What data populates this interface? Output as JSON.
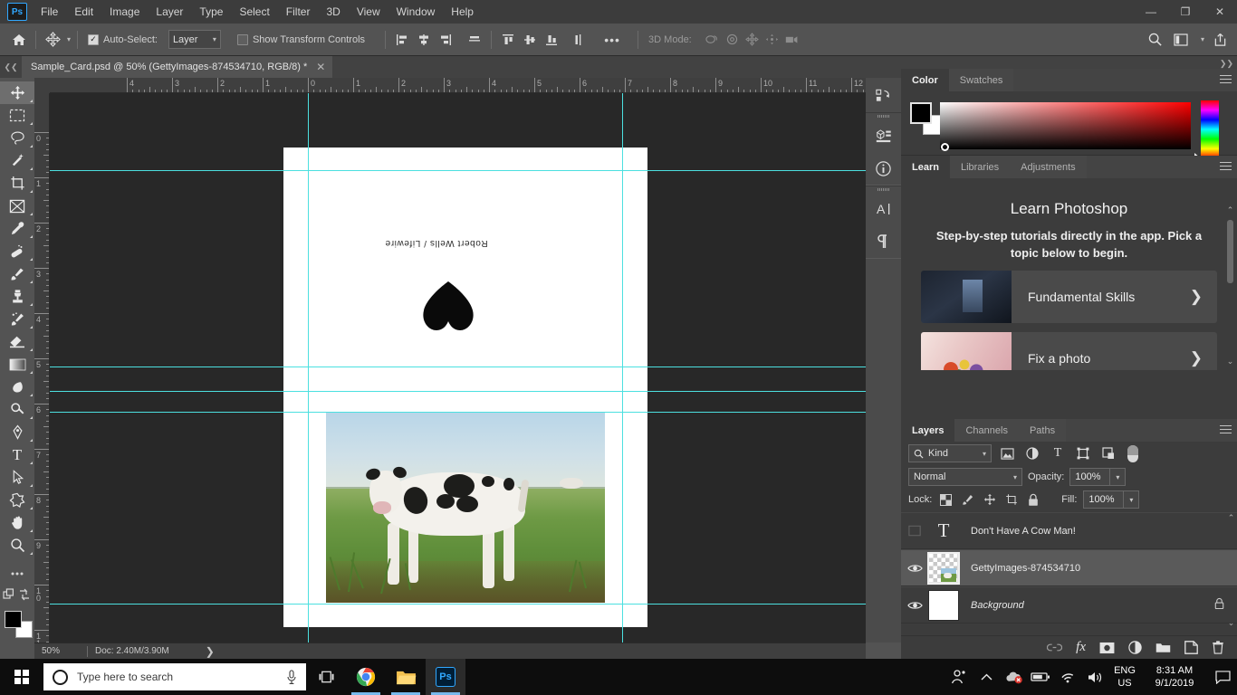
{
  "window": {
    "minimize": "—",
    "maximize": "❐",
    "close": "✕"
  },
  "menubar": {
    "logo": "Ps",
    "items": [
      "File",
      "Edit",
      "Image",
      "Layer",
      "Type",
      "Select",
      "Filter",
      "3D",
      "View",
      "Window",
      "Help"
    ]
  },
  "options_bar": {
    "home_icon": "home-icon",
    "tool_icon": "move-tool-icon",
    "auto_select_label": "Auto-Select:",
    "auto_select_checked": true,
    "layer_dropdown_value": "Layer",
    "show_transform_label": "Show Transform Controls",
    "show_transform_checked": false,
    "more_label": "•••",
    "three_d_label": "3D Mode:",
    "right_icons": [
      "search-icon",
      "workspace-icon",
      "chevron-down-icon",
      "share-icon"
    ]
  },
  "tabbar": {
    "document_title": "Sample_Card.psd @ 50% (GettyImages-874534710, RGB/8) *",
    "close_glyph": "✕",
    "collapse_glyph": "❮❮",
    "expand_glyph": "❯❯"
  },
  "toolbar": {
    "tools": [
      {
        "name": "move-tool",
        "active": true
      },
      {
        "name": "rectangular-marquee-tool",
        "active": false
      },
      {
        "name": "lasso-tool",
        "active": false
      },
      {
        "name": "magic-wand-tool",
        "active": false
      },
      {
        "name": "crop-tool",
        "active": false
      },
      {
        "name": "frame-tool",
        "active": false
      },
      {
        "name": "eyedropper-tool",
        "active": false
      },
      {
        "name": "spot-healing-brush-tool",
        "active": false
      },
      {
        "name": "brush-tool",
        "active": false
      },
      {
        "name": "clone-stamp-tool",
        "active": false
      },
      {
        "name": "history-brush-tool",
        "active": false
      },
      {
        "name": "eraser-tool",
        "active": false
      },
      {
        "name": "gradient-tool",
        "active": false
      },
      {
        "name": "blur-tool",
        "active": false
      },
      {
        "name": "dodge-tool",
        "active": false
      },
      {
        "name": "pen-tool",
        "active": false
      },
      {
        "name": "type-tool",
        "active": false
      },
      {
        "name": "path-selection-tool",
        "active": false
      },
      {
        "name": "custom-shape-tool",
        "active": false
      },
      {
        "name": "hand-tool",
        "active": false
      },
      {
        "name": "zoom-tool",
        "active": false
      },
      {
        "name": "edit-toolbar-more",
        "active": false
      }
    ],
    "foreground_color": "#000000",
    "background_color": "#ffffff"
  },
  "canvas": {
    "ruler_h_labels": [
      "4",
      "3",
      "2",
      "1",
      "0",
      "1",
      "2",
      "3",
      "4",
      "5",
      "6",
      "7",
      "8",
      "9",
      "10",
      "11",
      "12"
    ],
    "ruler_v_labels": [
      "0",
      "1",
      "2",
      "3",
      "4",
      "5",
      "6",
      "7",
      "8",
      "9",
      "10",
      "11"
    ],
    "credit_text": "Robert Wells / Lifewire",
    "guide_color": "#4ce0e0",
    "paper_color": "#ffffff"
  },
  "statusbar": {
    "zoom": "50%",
    "doc_info": "Doc: 2.40M/3.90M",
    "expand_glyph": "❯"
  },
  "icon_rail": {
    "items": [
      "history-icon",
      "3d-icon",
      "info-icon",
      "character-icon",
      "paragraph-icon"
    ]
  },
  "color_panel": {
    "tabs": [
      {
        "label": "Color",
        "active": true
      },
      {
        "label": "Swatches",
        "active": false
      }
    ],
    "foreground": "#000000",
    "background": "#ffffff"
  },
  "learn_panel": {
    "tabs": [
      {
        "label": "Learn",
        "active": true
      },
      {
        "label": "Libraries",
        "active": false
      },
      {
        "label": "Adjustments",
        "active": false
      }
    ],
    "title": "Learn Photoshop",
    "subtitle": "Step-by-step tutorials directly in the app. Pick a topic below to begin.",
    "cards": [
      {
        "label": "Fundamental Skills",
        "chevron": "❯"
      },
      {
        "label": "Fix a photo",
        "chevron": "❯"
      }
    ],
    "scroll_up": "⌃",
    "scroll_down": "⌄"
  },
  "layers_panel": {
    "tabs": [
      {
        "label": "Layers",
        "active": true
      },
      {
        "label": "Channels",
        "active": false
      },
      {
        "label": "Paths",
        "active": false
      }
    ],
    "filter_label": "Kind",
    "filter_icons": [
      "pixel-filter-icon",
      "adjustment-filter-icon",
      "type-filter-icon",
      "shape-filter-icon",
      "smart-object-filter-icon"
    ],
    "blend_mode": "Normal",
    "opacity_label": "Opacity:",
    "opacity_value": "100%",
    "lock_label": "Lock:",
    "lock_icons": [
      "lock-transparent-pixels-icon",
      "lock-image-pixels-icon",
      "lock-position-icon",
      "lock-artboard-icon",
      "lock-all-icon"
    ],
    "fill_label": "Fill:",
    "fill_value": "100%",
    "layers": [
      {
        "name": "Don't Have A Cow Man!",
        "visible": false,
        "selected": false,
        "type": "text",
        "locked": false
      },
      {
        "name": "GettyImages-874534710",
        "visible": true,
        "selected": true,
        "type": "image",
        "locked": false
      },
      {
        "name": "Background",
        "visible": true,
        "selected": false,
        "type": "background",
        "locked": true
      }
    ],
    "footer_icons": [
      "link-layers-icon",
      "layer-style-icon",
      "layer-mask-icon",
      "adjustment-layer-icon",
      "new-group-icon",
      "new-layer-icon",
      "delete-layer-icon"
    ],
    "footer_fx": "fx"
  },
  "taskbar": {
    "search_placeholder": "Type here to search",
    "buttons": [
      "cortana-icon",
      "microphone-icon",
      "task-view-icon",
      "chrome-icon",
      "file-explorer-icon",
      "photoshop-icon"
    ],
    "tray_icons": [
      "people-icon",
      "show-hidden-icons-icon",
      "onedrive-error-icon",
      "battery-icon",
      "wifi-icon",
      "volume-icon"
    ],
    "language": "ENG",
    "region": "US",
    "time": "8:31 AM",
    "date": "9/1/2019",
    "notification_icon": "action-center-icon"
  }
}
